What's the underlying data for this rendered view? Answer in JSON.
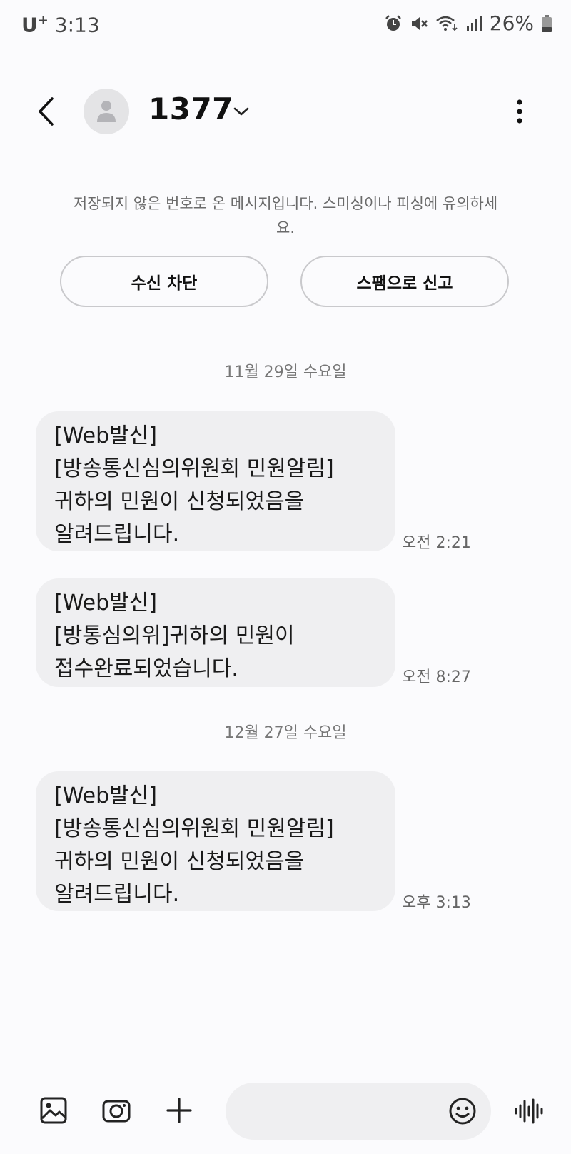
{
  "status_bar": {
    "carrier_main": "U",
    "carrier_sup": "+",
    "time": "3:13",
    "battery": "26%"
  },
  "header": {
    "contact_name": "1377"
  },
  "warning": {
    "text": "저장되지 않은 번호로 온 메시지입니다. 스미싱이나 피싱에 유의하세요.",
    "block_label": "수신 차단",
    "spam_label": "스팸으로 신고"
  },
  "conversation": {
    "dates": [
      "11월 29일 수요일",
      "12월 27일 수요일"
    ],
    "messages": [
      {
        "text": "[Web발신]\n[방송통신심의위원회 민원알림]\n귀하의 민원이 신청되었음을\n알려드립니다.",
        "time": "오전 2:21"
      },
      {
        "text": "[Web발신]\n[방통심의위]귀하의 민원이\n접수완료되었습니다.",
        "time": "오전 8:27"
      },
      {
        "text": "[Web발신]\n[방송통신심의위원회 민원알림]\n귀하의 민원이 신청되었음을\n알려드립니다.",
        "time": "오후 3:13"
      }
    ]
  },
  "input_bar": {
    "placeholder": "",
    "icons": [
      "gallery-icon",
      "camera-icon",
      "plus-icon",
      "emoji-icon",
      "voice-icon"
    ]
  }
}
